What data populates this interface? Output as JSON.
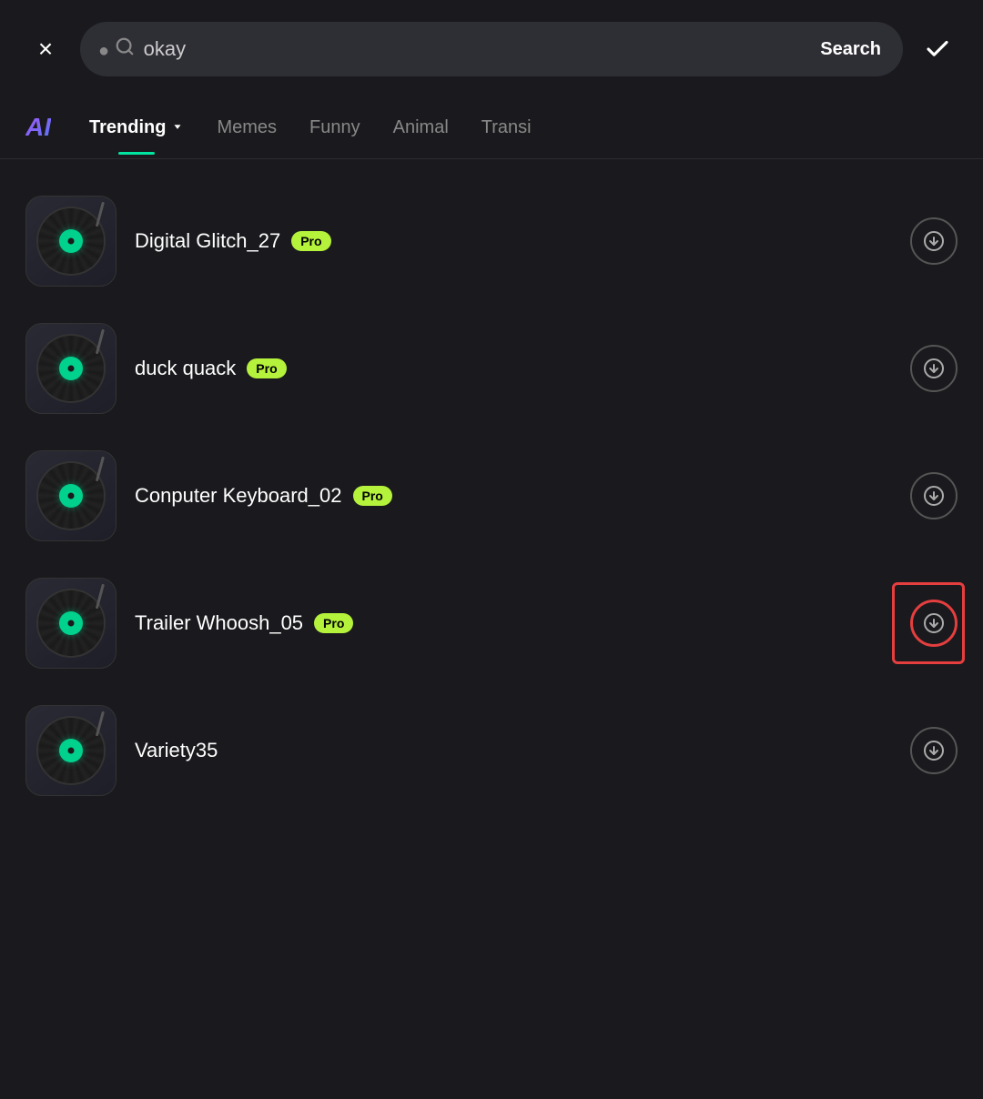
{
  "header": {
    "close_label": "×",
    "confirm_label": "✓",
    "search_placeholder": "okay",
    "search_button_label": "Search"
  },
  "tabs": {
    "ai_label": "AI",
    "items": [
      {
        "id": "trending",
        "label": "Trending",
        "active": true,
        "has_dropdown": true
      },
      {
        "id": "memes",
        "label": "Memes",
        "active": false,
        "has_dropdown": false
      },
      {
        "id": "funny",
        "label": "Funny",
        "active": false,
        "has_dropdown": false
      },
      {
        "id": "animal",
        "label": "Animal",
        "active": false,
        "has_dropdown": false
      },
      {
        "id": "transi",
        "label": "Transi",
        "active": false,
        "has_dropdown": false
      }
    ]
  },
  "sounds": [
    {
      "id": 1,
      "name": "Digital Glitch_27",
      "pro": true,
      "highlighted": false
    },
    {
      "id": 2,
      "name": "duck quack",
      "pro": true,
      "highlighted": false
    },
    {
      "id": 3,
      "name": "Conputer Keyboard_02",
      "pro": true,
      "highlighted": false
    },
    {
      "id": 4,
      "name": "Trailer Whoosh_05",
      "pro": true,
      "highlighted": true
    },
    {
      "id": 5,
      "name": "Variety35",
      "pro": false,
      "highlighted": false
    }
  ],
  "badges": {
    "pro_label": "Pro"
  },
  "icons": {
    "search": "🔍",
    "download": "⊙",
    "chevron_down": "▼"
  }
}
